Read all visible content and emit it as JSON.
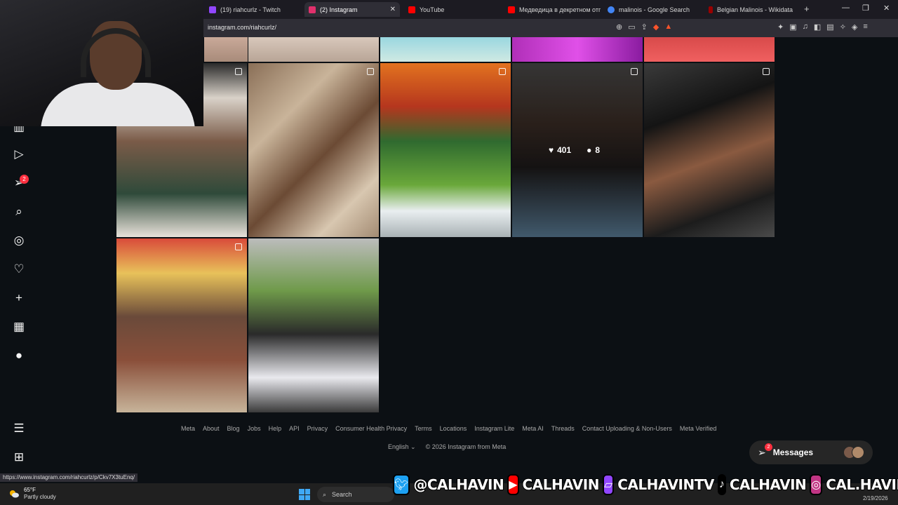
{
  "browser": {
    "tabs": [
      {
        "title": "(19) riahcurlz - Twitch",
        "color": "#9146ff",
        "active": false
      },
      {
        "title": "(2) Instagram",
        "color": "#e1306c",
        "active": true
      },
      {
        "title": "YouTube",
        "color": "#ff0000",
        "active": false
      },
      {
        "title": "Медведица в декретном отп",
        "color": "#ff0000",
        "active": false
      },
      {
        "title": "malinois - Google Search",
        "color": "#4285f4",
        "active": false
      },
      {
        "title": "Belgian Malinois - Wikidata",
        "color": "#990000",
        "active": false
      }
    ],
    "tab_close": "✕",
    "new_tab": "+",
    "window_controls": [
      "—",
      "❐",
      "✕"
    ],
    "url": "instagram.com/riahcurlz/"
  },
  "sidebar": {
    "icons": [
      "reels-icon",
      "video-icon",
      "messenger-icon",
      "search-icon",
      "explore-icon",
      "heart-icon",
      "create-icon",
      "insights-icon",
      "profile-icon",
      "menu-icon",
      "apps-icon"
    ],
    "notification_count": "2"
  },
  "post_hover": {
    "likes": "401",
    "comments": "8"
  },
  "footer": {
    "links": [
      "Meta",
      "About",
      "Blog",
      "Jobs",
      "Help",
      "API",
      "Privacy",
      "Consumer Health Privacy",
      "Terms",
      "Locations",
      "Instagram Lite",
      "Meta AI",
      "Threads",
      "Contact Uploading & Non-Users",
      "Meta Verified"
    ],
    "language": "English ⌄",
    "copyright": "© 2026 Instagram from Meta"
  },
  "messages": {
    "label": "Messages",
    "badge": "2"
  },
  "status_bar": {
    "url": "https://www.instagram.com/riahcurlz/p/Ckv7X3tuEnq/"
  },
  "stream_banner": {
    "twitter": "@CALHAVIN",
    "youtube": "CALHAVIN",
    "twitch": "CALHAVINTV",
    "tiktok": "CALHAVIN",
    "instagram": "CAL.HAVIN"
  },
  "taskbar": {
    "temperature": "65°F",
    "weather": "Partly cloudy",
    "search_label": "Search",
    "date": "2/19/2026"
  },
  "colors": {
    "background": "#0c1014",
    "badge": "#ff3040",
    "instagram_accent": "#e1306c"
  }
}
